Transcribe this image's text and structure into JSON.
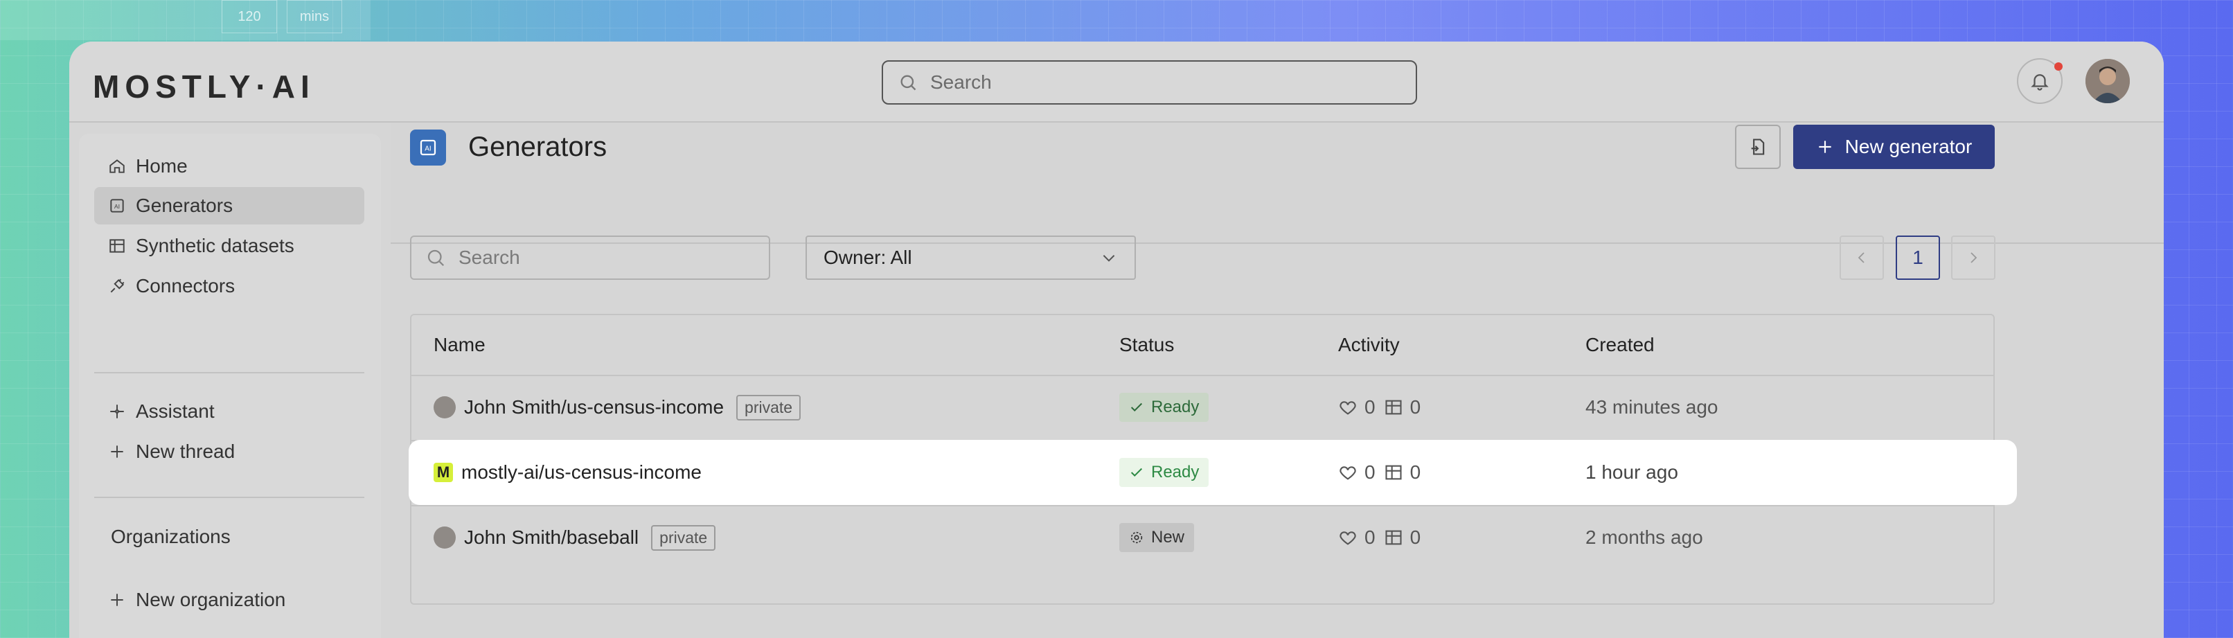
{
  "background": {
    "cell_a": "120",
    "cell_b": "mins"
  },
  "app": {
    "logo": "MOSTLY·AI"
  },
  "topbar": {
    "search_placeholder": "Search"
  },
  "sidebar": {
    "items": [
      {
        "label": "Home",
        "icon": "home-icon"
      },
      {
        "label": "Generators",
        "icon": "generator-icon",
        "active": true
      },
      {
        "label": "Synthetic datasets",
        "icon": "table-icon"
      },
      {
        "label": "Connectors",
        "icon": "plug-icon"
      }
    ],
    "assistant": [
      {
        "label": "Assistant",
        "icon": "sparkle-icon"
      },
      {
        "label": "New thread",
        "icon": "plus-icon"
      }
    ],
    "organizations_title": "Organizations",
    "new_org": "New organization"
  },
  "main": {
    "title": "Generators",
    "new_generator": "New generator",
    "search_placeholder": "Search",
    "owner_filter": "Owner: All",
    "page": "1"
  },
  "table": {
    "headers": [
      "Name",
      "Status",
      "Activity",
      "Created"
    ],
    "rows": [
      {
        "name": "John Smith/us-census-income",
        "visibility": "private",
        "status": "Ready",
        "likes": "0",
        "datasets": "0",
        "created": "43 minutes ago"
      },
      {
        "name": "mostly-ai/us-census-income",
        "badge": "M",
        "status": "Ready",
        "likes": "0",
        "datasets": "0",
        "created": "1 hour ago"
      },
      {
        "name": "John Smith/baseball",
        "visibility": "private",
        "status": "New",
        "likes": "0",
        "datasets": "0",
        "created": "2 months ago"
      }
    ]
  },
  "colors": {
    "primary": "#2f3d84",
    "ready": "#2d8a44",
    "badge": "#d6ef3a"
  }
}
